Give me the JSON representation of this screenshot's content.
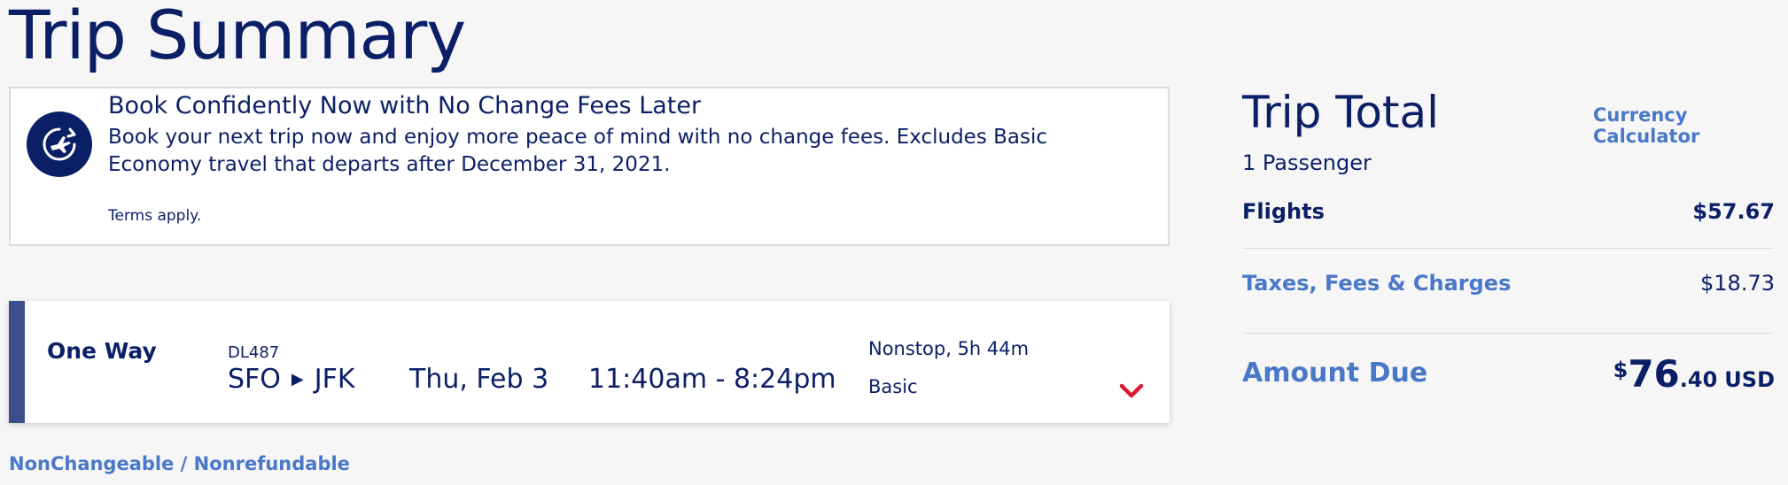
{
  "page": {
    "title": "Trip Summary"
  },
  "promo": {
    "icon": "airplane-clock-icon",
    "title": "Book Confidently Now with No Change Fees Later",
    "body": "Book your next trip now and enjoy more peace of mind with no change fees. Excludes Basic Economy travel that departs after December 31, 2021.",
    "terms": "Terms apply."
  },
  "flight": {
    "trip_type": "One Way",
    "flight_number": "DL487",
    "origin": "SFO",
    "destination": "JFK",
    "date": "Thu, Feb 3",
    "time": "11:40am - 8:24pm",
    "stops": "Nonstop, 5h 44m",
    "fare_class": "Basic"
  },
  "fare_rule": "NonChangeable / Nonrefundable",
  "trip_total": {
    "title": "Trip Total",
    "currency_link": "Currency Calculator",
    "passengers": "1 Passenger",
    "flights_label": "Flights",
    "flights_value": "$57.67",
    "taxes_label": "Taxes, Fees & Charges",
    "taxes_value": "$18.73",
    "amount_label": "Amount Due",
    "amount_symbol": "$",
    "amount_dollars": "76",
    "amount_cents": ".40",
    "amount_currency": "USD"
  },
  "colors": {
    "navy": "#0b1f66",
    "link_blue": "#4a78c8",
    "chevron_red": "#e01933",
    "accent_bar": "#3b4f8a"
  }
}
